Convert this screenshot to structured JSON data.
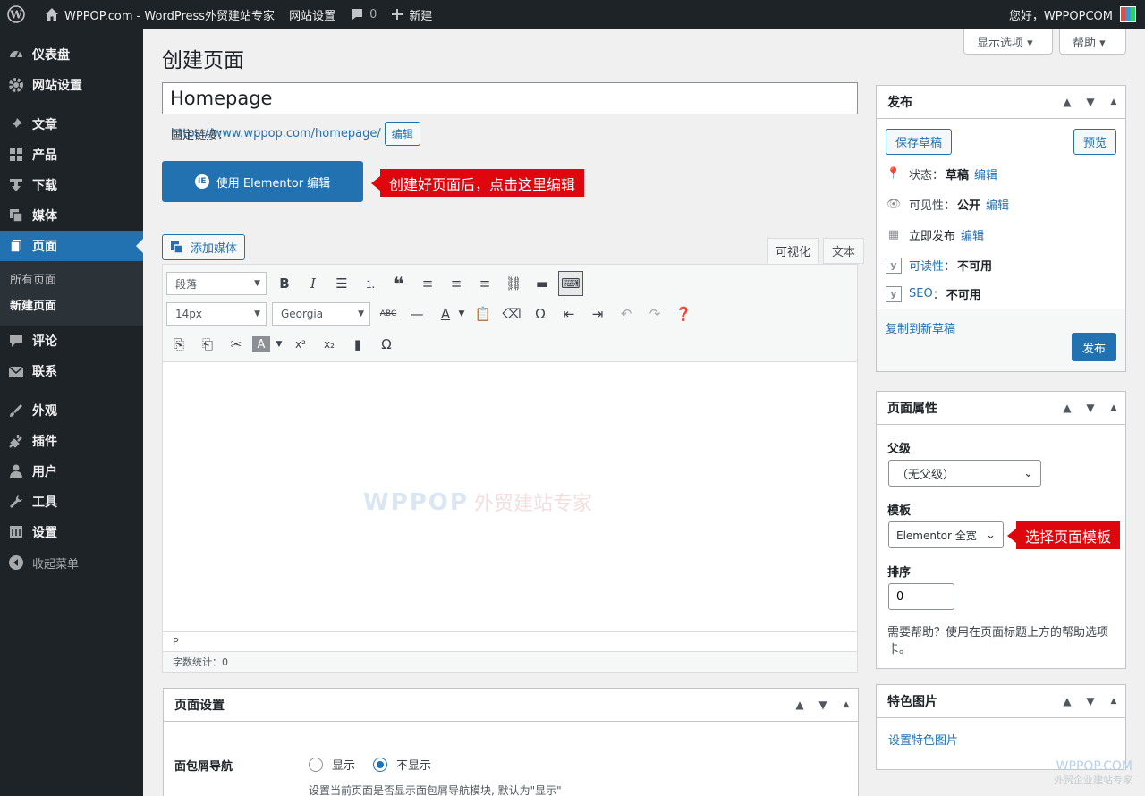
{
  "adminbar": {
    "site_name": "WPPOP.com - WordPress外贸建站专家",
    "site_settings": "网站设置",
    "comments_count": "0",
    "new_label": "新建",
    "greeting": "您好，WPPOPCOM"
  },
  "sidebar": {
    "items": [
      {
        "label": "仪表盘",
        "icon": "dashboard-icon"
      },
      {
        "label": "网站设置",
        "icon": "gear-icon"
      },
      {
        "label": "文章",
        "icon": "pin-icon"
      },
      {
        "label": "产品",
        "icon": "grid-icon"
      },
      {
        "label": "下载",
        "icon": "download-icon"
      },
      {
        "label": "媒体",
        "icon": "media-icon"
      },
      {
        "label": "页面",
        "icon": "page-icon"
      },
      {
        "label": "评论",
        "icon": "comment-icon"
      },
      {
        "label": "联系",
        "icon": "mail-icon"
      },
      {
        "label": "外观",
        "icon": "brush-icon"
      },
      {
        "label": "插件",
        "icon": "plug-icon"
      },
      {
        "label": "用户",
        "icon": "user-icon"
      },
      {
        "label": "工具",
        "icon": "wrench-icon"
      },
      {
        "label": "设置",
        "icon": "settings-icon"
      }
    ],
    "sub_items": [
      "所有页面",
      "新建页面"
    ],
    "collapse": "收起菜单"
  },
  "header": {
    "screen_options": "显示选项 ▾",
    "help": "帮助 ▾",
    "page_title": "创建页面"
  },
  "editor": {
    "title_value": "Homepage",
    "permalink_label": "固定链接：",
    "permalink_url": "https://www.wppop.com/homepage/",
    "permalink_edit": "编辑",
    "elementor_button": "使用 Elementor 编辑",
    "callout_elementor": "创建好页面后，点击这里编辑",
    "add_media": "添加媒体",
    "tab_visual": "可视化",
    "tab_text": "文本",
    "format_select": "段落",
    "size_select": "14px",
    "font_select": "Georgia",
    "path": "P",
    "word_count": "字数统计：0",
    "watermark": "WPPOP",
    "watermark_sub": "外贸建站专家"
  },
  "page_settings": {
    "title": "页面设置",
    "breadcrumb_label": "面包屑导航",
    "option_show": "显示",
    "option_hide": "不显示",
    "selected": "不显示",
    "hint": "设置当前页面是否显示面包屑导航模块, 默认为\"显示\""
  },
  "publish": {
    "title": "发布",
    "save_draft": "保存草稿",
    "preview": "预览",
    "status_label": "状态：",
    "status_value": "草稿",
    "visibility_label": "可见性：",
    "visibility_value": "公开",
    "publish_time": "立即发布",
    "edit": "编辑",
    "readability_label": "可读性",
    "readability_value": "不可用",
    "seo_label": "SEO",
    "seo_value": "不可用",
    "copy_draft": "复制到新草稿",
    "publish_button": "发布"
  },
  "attributes": {
    "title": "页面属性",
    "parent_label": "父级",
    "parent_value": "（无父级）",
    "template_label": "模板",
    "template_value": "Elementor 全宽",
    "callout_template": "选择页面模板",
    "order_label": "排序",
    "order_value": "0",
    "help_text": "需要帮助？使用在页面标题上方的帮助选项卡。"
  },
  "featured": {
    "title": "特色图片",
    "link": "设置特色图片"
  },
  "brand": {
    "name": "WPPOP.COM",
    "tagline": "外贸企业建站专家"
  },
  "colors": {
    "admin_bar": "#1d2327",
    "accent": "#2271b1",
    "callout": "#e0060d"
  }
}
